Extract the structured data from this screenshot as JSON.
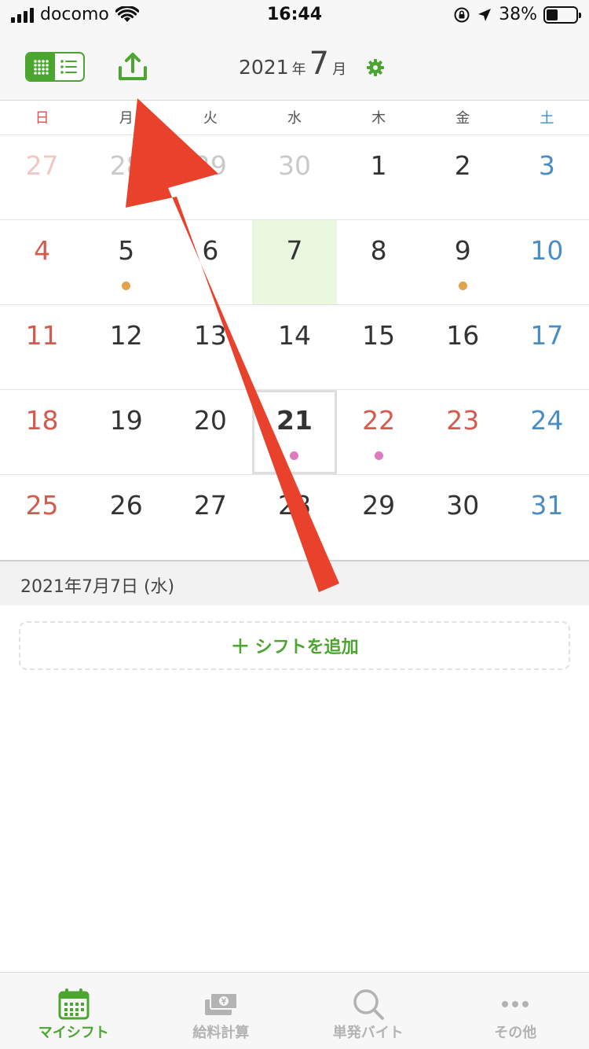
{
  "status_bar": {
    "carrier": "docomo",
    "time": "16:44",
    "battery": "38%",
    "battery_level": 0.38
  },
  "header": {
    "year": "2021",
    "year_unit": "年",
    "month": "7",
    "month_unit": "月"
  },
  "weekdays": [
    "日",
    "月",
    "火",
    "水",
    "木",
    "金",
    "土"
  ],
  "calendar": {
    "weeks": [
      [
        {
          "day": "27",
          "other": true
        },
        {
          "day": "28",
          "other": true
        },
        {
          "day": "29",
          "other": true
        },
        {
          "day": "30",
          "other": true
        },
        {
          "day": "1"
        },
        {
          "day": "2"
        },
        {
          "day": "3"
        }
      ],
      [
        {
          "day": "4"
        },
        {
          "day": "5",
          "dot": "orange"
        },
        {
          "day": "6"
        },
        {
          "day": "7",
          "selected": true
        },
        {
          "day": "8"
        },
        {
          "day": "9",
          "dot": "orange"
        },
        {
          "day": "10"
        }
      ],
      [
        {
          "day": "11"
        },
        {
          "day": "12"
        },
        {
          "day": "13"
        },
        {
          "day": "14"
        },
        {
          "day": "15"
        },
        {
          "day": "16"
        },
        {
          "day": "17"
        }
      ],
      [
        {
          "day": "18"
        },
        {
          "day": "19"
        },
        {
          "day": "20"
        },
        {
          "day": "21",
          "today": true,
          "dot": "pink"
        },
        {
          "day": "22",
          "holiday": true,
          "dot": "pink"
        },
        {
          "day": "23",
          "holiday": true
        },
        {
          "day": "24"
        }
      ],
      [
        {
          "day": "25"
        },
        {
          "day": "26"
        },
        {
          "day": "27"
        },
        {
          "day": "28"
        },
        {
          "day": "29"
        },
        {
          "day": "30"
        },
        {
          "day": "31"
        }
      ]
    ]
  },
  "selected_date": {
    "label": "2021年7月7日 (水)"
  },
  "add_shift": {
    "icon": "+",
    "label": "シフトを追加"
  },
  "tabs": [
    {
      "label": "マイシフト",
      "icon": "calendar-icon",
      "active": true
    },
    {
      "label": "給料計算",
      "icon": "money-icon",
      "active": false
    },
    {
      "label": "単発バイト",
      "icon": "search-icon",
      "active": false
    },
    {
      "label": "その他",
      "icon": "more-icon",
      "active": false
    }
  ],
  "colors": {
    "accent": "#4aa62f",
    "sunday": "#d45a4d",
    "saturday": "#4a8dc3",
    "selected_bg": "#eaf8df",
    "annotation_arrow": "#e8412c"
  }
}
